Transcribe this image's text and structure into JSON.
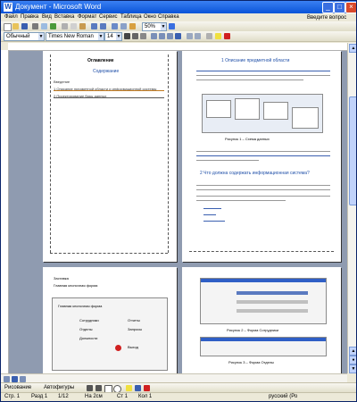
{
  "window": {
    "title": "Документ - Microsoft Word",
    "min_label": "_",
    "max_label": "□",
    "close_label": "×",
    "app_icon": "W"
  },
  "menu": {
    "items": [
      "Файл",
      "Правка",
      "Вид",
      "Вставка",
      "Формат",
      "Сервис",
      "Таблица",
      "Окно",
      "Справка"
    ],
    "help_hint": "Введите вопрос"
  },
  "toolbar": {
    "style_value": "Обычный",
    "font_value": "Times New Roman",
    "size_value": "14",
    "zoom_value": "50%",
    "icons": [
      "new-icon",
      "open-icon",
      "save-icon",
      "print-icon",
      "preview-icon",
      "spell-icon",
      "cut-icon",
      "copy-icon",
      "paste-icon",
      "undo-icon",
      "redo-icon",
      "table-icon",
      "columns-icon",
      "drawing-icon",
      "zoom-icon",
      "help-icon"
    ]
  },
  "pages": {
    "p1": {
      "heading": "Оглавление",
      "subtitle": "Содержание",
      "toc_lines": [
        "Введение",
        "1 Описание предметной области и информационной системы",
        "2 Проектирование базы данных"
      ]
    },
    "p2": {
      "heading": "1 Описание предметной области",
      "figure_caption": "Рисунок 1 – Схема данных",
      "question": "2 Что должна содержать информационная система?"
    },
    "p3": {
      "lines": [
        "Заставка",
        "Главная кнопочная форма"
      ],
      "form_title": "Главная кнопочная форма",
      "buttons": [
        "Сотрудники",
        "Отделы",
        "Должности",
        "Отчеты",
        "Запросы",
        "Выход"
      ]
    },
    "p4": {
      "fig1": "Рисунок 2 – Форма Сотрудники",
      "fig2": "Рисунок 3 – Форма Отделы"
    }
  },
  "drawbar": {
    "draw_label": "Рисование",
    "autoshapes_label": "Автофигуры"
  },
  "status": {
    "page": "Стр. 1",
    "section": "Разд 1",
    "pages": "1/12",
    "pos": "На 2см",
    "line": "Ст 1",
    "col": "Кол 1",
    "lang": "русский (Ро"
  },
  "colors": {
    "accent": "#0a54d8",
    "workspace": "#8f9bb0"
  }
}
